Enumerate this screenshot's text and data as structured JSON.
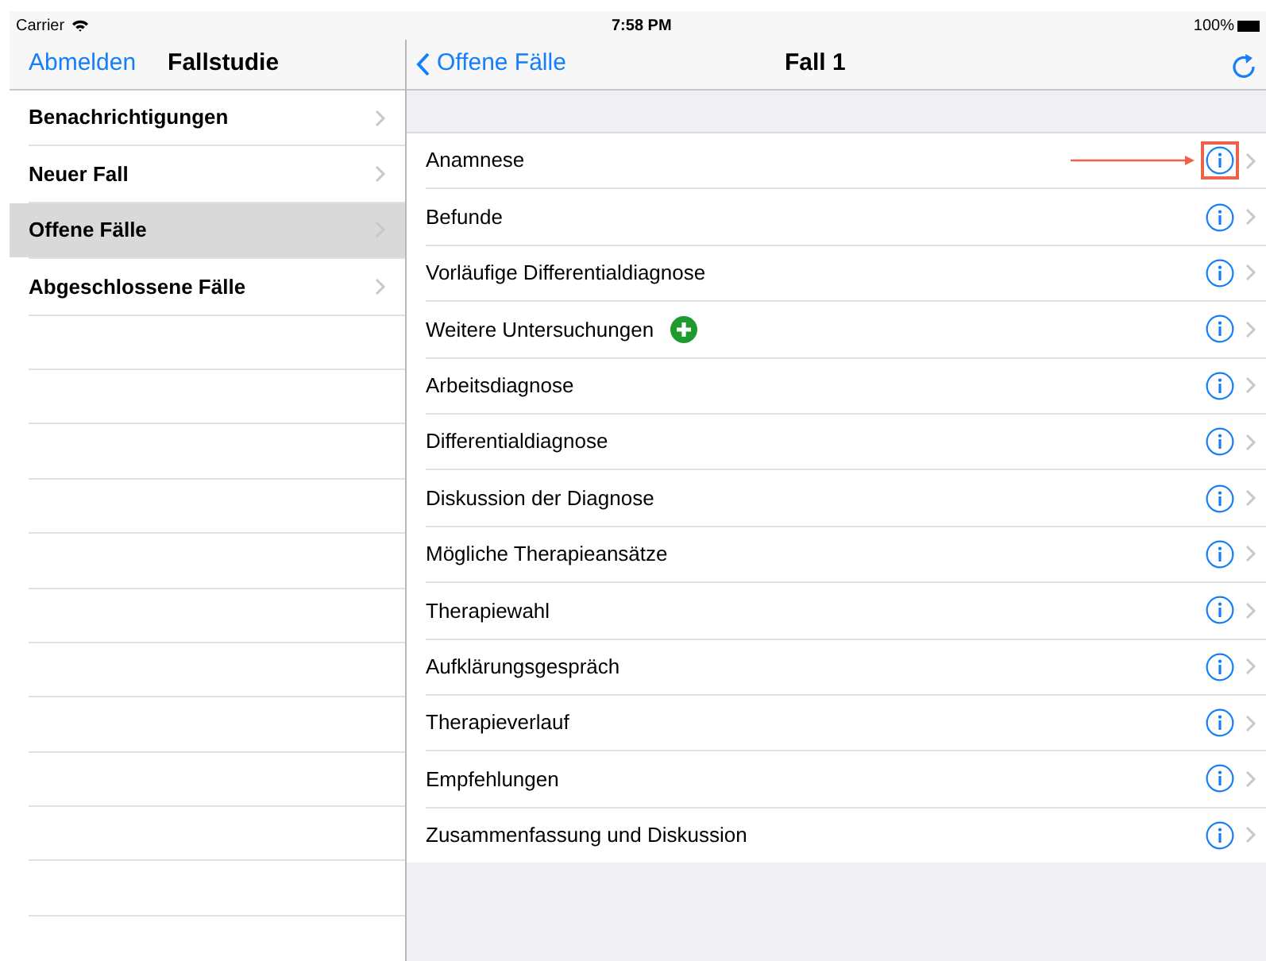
{
  "status_bar": {
    "carrier": "Carrier",
    "time": "7:58 PM",
    "battery": "100%"
  },
  "master": {
    "back_button": "Abmelden",
    "title": "Fallstudie",
    "items": [
      {
        "label": "Benachrichtigungen",
        "selected": false
      },
      {
        "label": "Neuer Fall",
        "selected": false
      },
      {
        "label": "Offene Fälle",
        "selected": true
      },
      {
        "label": "Abgeschlossene Fälle",
        "selected": false
      }
    ]
  },
  "detail": {
    "back_button": "Offene Fälle",
    "title": "Fall 1",
    "rows": [
      {
        "label": "Anamnese",
        "add_button": false,
        "highlighted": true
      },
      {
        "label": "Befunde",
        "add_button": false,
        "highlighted": false
      },
      {
        "label": "Vorläufige Differentialdiagnose",
        "add_button": false,
        "highlighted": false
      },
      {
        "label": "Weitere Untersuchungen",
        "add_button": true,
        "highlighted": false
      },
      {
        "label": "Arbeitsdiagnose",
        "add_button": false,
        "highlighted": false
      },
      {
        "label": "Differentialdiagnose",
        "add_button": false,
        "highlighted": false
      },
      {
        "label": "Diskussion der Diagnose",
        "add_button": false,
        "highlighted": false
      },
      {
        "label": "Mögliche Therapieansätze",
        "add_button": false,
        "highlighted": false
      },
      {
        "label": "Therapiewahl",
        "add_button": false,
        "highlighted": false
      },
      {
        "label": "Aufklärungsgespräch",
        "add_button": false,
        "highlighted": false
      },
      {
        "label": "Therapieverlauf",
        "add_button": false,
        "highlighted": false
      },
      {
        "label": "Empfehlungen",
        "add_button": false,
        "highlighted": false
      },
      {
        "label": "Zusammenfassung und Diskussion",
        "add_button": false,
        "highlighted": false
      }
    ]
  }
}
